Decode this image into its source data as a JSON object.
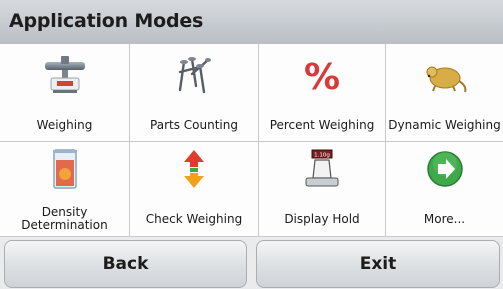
{
  "header": {
    "title": "Application Modes"
  },
  "modes": [
    {
      "label": "Weighing",
      "icon": "scale-icon"
    },
    {
      "label": "Parts Counting",
      "icon": "nails-icon"
    },
    {
      "label": "Percent Weighing",
      "icon": "percent-icon"
    },
    {
      "label": "Dynamic Weighing",
      "icon": "mouse-icon"
    },
    {
      "label": "Density Determination",
      "icon": "beaker-icon"
    },
    {
      "label": "Check Weighing",
      "icon": "up-down-arrows-icon"
    },
    {
      "label": "Display Hold",
      "icon": "hold-scale-icon",
      "display_value": "1.10g"
    },
    {
      "label": "More...",
      "icon": "arrow-right-icon"
    }
  ],
  "footer": {
    "back_label": "Back",
    "exit_label": "Exit"
  },
  "colors": {
    "percent": "#d83a3a",
    "arrow_green": "#3ea84a",
    "arrow_up": "#e23b2e",
    "arrow_down": "#f0a21a",
    "mouse": "#d8ad45"
  }
}
